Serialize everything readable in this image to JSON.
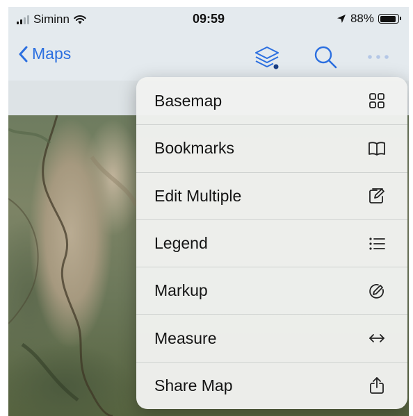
{
  "status_bar": {
    "carrier": "Siminn",
    "time": "09:59",
    "battery": "88%",
    "battery_level": 0.88,
    "icons": [
      "signal-icon",
      "wifi-icon",
      "location-arrow-icon",
      "battery-icon"
    ]
  },
  "nav": {
    "back_label": "Maps",
    "accent_color": "#2b6fe0",
    "icons": [
      "chevron-left-icon",
      "layers-icon",
      "search-icon",
      "more-icon"
    ]
  },
  "menu": {
    "items": [
      {
        "label": "Basemap",
        "icon": "basemap-grid-icon"
      },
      {
        "label": "Bookmarks",
        "icon": "bookmarks-book-icon"
      },
      {
        "label": "Edit Multiple",
        "icon": "edit-multiple-icon"
      },
      {
        "label": "Legend",
        "icon": "legend-list-icon"
      },
      {
        "label": "Markup",
        "icon": "markup-pen-icon"
      },
      {
        "label": "Measure",
        "icon": "measure-arrows-icon"
      },
      {
        "label": "Share Map",
        "icon": "share-icon"
      }
    ]
  }
}
